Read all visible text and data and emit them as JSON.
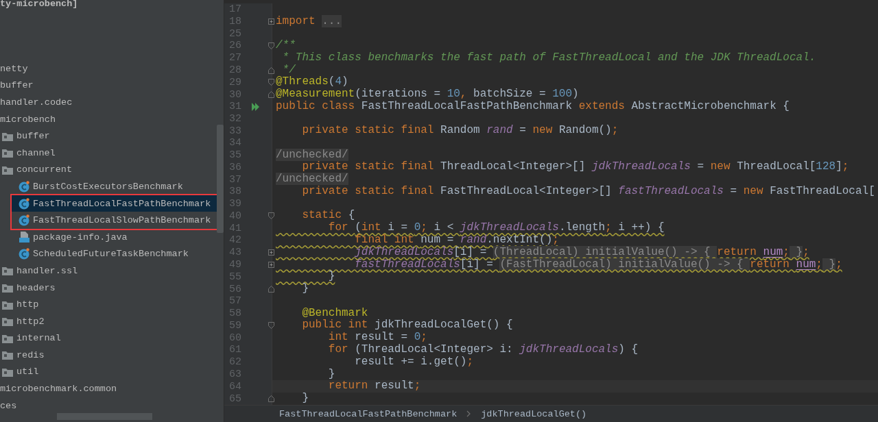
{
  "project_tree": {
    "header": "ty-microbench]",
    "items": [
      {
        "label": "netty",
        "kind": "package",
        "selected": false,
        "marked": false
      },
      {
        "label": "buffer",
        "kind": "package",
        "selected": false,
        "marked": false
      },
      {
        "label": "handler.codec",
        "kind": "package",
        "selected": false,
        "marked": false
      },
      {
        "label": "microbench",
        "kind": "package",
        "selected": false,
        "marked": false,
        "children": [
          {
            "label": "buffer",
            "kind": "folder",
            "selected": false,
            "marked": false
          },
          {
            "label": "channel",
            "kind": "folder",
            "selected": false,
            "marked": false
          },
          {
            "label": "concurrent",
            "kind": "folder",
            "selected": false,
            "marked": false,
            "children": [
              {
                "label": "BurstCostExecutorsBenchmark",
                "kind": "class",
                "selected": false,
                "marked": false
              },
              {
                "label": "FastThreadLocalFastPathBenchmark",
                "kind": "class",
                "selected": true,
                "marked": true
              },
              {
                "label": "FastThreadLocalSlowPathBenchmark",
                "kind": "class",
                "selected": false,
                "marked": true
              },
              {
                "label": "package-info.java",
                "kind": "java-file",
                "selected": false,
                "marked": false
              },
              {
                "label": "ScheduledFutureTaskBenchmark",
                "kind": "class",
                "selected": false,
                "marked": false
              }
            ]
          },
          {
            "label": "handler.ssl",
            "kind": "folder",
            "selected": false,
            "marked": false
          },
          {
            "label": "headers",
            "kind": "folder",
            "selected": false,
            "marked": false
          },
          {
            "label": "http",
            "kind": "folder",
            "selected": false,
            "marked": false
          },
          {
            "label": "http2",
            "kind": "folder",
            "selected": false,
            "marked": false
          },
          {
            "label": "internal",
            "kind": "folder",
            "selected": false,
            "marked": false
          },
          {
            "label": "redis",
            "kind": "folder",
            "selected": false,
            "marked": false
          },
          {
            "label": "util",
            "kind": "folder",
            "selected": false,
            "marked": false
          }
        ]
      },
      {
        "label": "microbenchmark.common",
        "kind": "package",
        "selected": false,
        "marked": false
      },
      {
        "label": "ces",
        "kind": "package",
        "selected": false,
        "marked": false
      }
    ]
  },
  "editor": {
    "lines": [
      {
        "n": "17"
      },
      {
        "n": "18",
        "fold": {
          "kind": "collapsed"
        },
        "tokens": [
          {
            "kind": "kw",
            "t": "import "
          },
          {
            "kind": "folded",
            "t": "..."
          }
        ]
      },
      {
        "n": "25"
      },
      {
        "n": "26",
        "fold": {
          "kind": "open"
        },
        "tokens": [
          {
            "kind": "doc",
            "t": "/**"
          }
        ]
      },
      {
        "n": "27",
        "tokens": [
          {
            "kind": "doc",
            "t": " * This class benchmarks the fast path of FastThreadLocal and the JDK ThreadLocal."
          }
        ]
      },
      {
        "n": "28",
        "fold": {
          "kind": "close"
        },
        "tokens": [
          {
            "kind": "doc",
            "t": " */"
          }
        ]
      },
      {
        "n": "29",
        "fold": {
          "kind": "open"
        },
        "tokens": [
          {
            "kind": "ann",
            "t": "@Threads"
          },
          {
            "kind": "plain",
            "t": "("
          },
          {
            "kind": "num",
            "t": "4"
          },
          {
            "kind": "plain",
            "t": ")"
          }
        ]
      },
      {
        "n": "30",
        "fold": {
          "kind": "close"
        },
        "tokens": [
          {
            "kind": "ann",
            "t": "@Measurement"
          },
          {
            "kind": "plain",
            "t": "(iterations = "
          },
          {
            "kind": "num",
            "t": "10"
          },
          {
            "kind": "kw",
            "t": ", "
          },
          {
            "kind": "plain",
            "t": "batchSize = "
          },
          {
            "kind": "num",
            "t": "100"
          },
          {
            "kind": "plain",
            "t": ")"
          }
        ]
      },
      {
        "n": "31",
        "run": true,
        "tokens": [
          {
            "kind": "kw",
            "t": "public class "
          },
          {
            "kind": "plain",
            "t": "FastThreadLocalFastPathBenchmark "
          },
          {
            "kind": "kw",
            "t": "extends "
          },
          {
            "kind": "plain",
            "t": "AbstractMicrobenchmark {"
          }
        ]
      },
      {
        "n": "32"
      },
      {
        "n": "33",
        "tokens": [
          {
            "kind": "kw",
            "t": "    private static final "
          },
          {
            "kind": "plain",
            "t": "Random "
          },
          {
            "kind": "field",
            "t": "rand"
          },
          {
            "kind": "plain",
            "t": " = "
          },
          {
            "kind": "kw",
            "t": "new "
          },
          {
            "kind": "plain",
            "t": "Random()"
          },
          {
            "kind": "kw",
            "t": ";"
          }
        ]
      },
      {
        "n": "34"
      },
      {
        "n": "35",
        "tokens": [
          {
            "kind": "folded",
            "t": "/unchecked/"
          }
        ]
      },
      {
        "n": "36",
        "tokens": [
          {
            "kind": "kw",
            "t": "    private static final "
          },
          {
            "kind": "plain",
            "t": "ThreadLocal<Integer>[] "
          },
          {
            "kind": "field",
            "t": "jdkThreadLocals"
          },
          {
            "kind": "plain",
            "t": " = "
          },
          {
            "kind": "kw",
            "t": "new "
          },
          {
            "kind": "plain",
            "t": "ThreadLocal["
          },
          {
            "kind": "num",
            "t": "128"
          },
          {
            "kind": "plain",
            "t": "]"
          },
          {
            "kind": "kw",
            "t": ";"
          }
        ]
      },
      {
        "n": "37",
        "tokens": [
          {
            "kind": "folded",
            "t": "/unchecked/"
          }
        ]
      },
      {
        "n": "38",
        "tokens": [
          {
            "kind": "kw",
            "t": "    private static final "
          },
          {
            "kind": "plain",
            "t": "FastThreadLocal<Integer>[] "
          },
          {
            "kind": "field",
            "t": "fastThreadLocals"
          },
          {
            "kind": "plain",
            "t": " = "
          },
          {
            "kind": "kw",
            "t": "new "
          },
          {
            "kind": "plain",
            "t": "FastThreadLocal["
          }
        ]
      },
      {
        "n": "39"
      },
      {
        "n": "40",
        "fold": {
          "kind": "open"
        },
        "tokens": [
          {
            "kind": "kw",
            "t": "    static "
          },
          {
            "kind": "plain",
            "t": "{"
          }
        ]
      },
      {
        "n": "41",
        "warning": true,
        "tokens": [
          {
            "kind": "kw",
            "t": "        for "
          },
          {
            "kind": "plain",
            "t": "("
          },
          {
            "kind": "kw",
            "t": "int "
          },
          {
            "kind": "plain",
            "t": "i = "
          },
          {
            "kind": "num",
            "t": "0"
          },
          {
            "kind": "kw",
            "t": "; "
          },
          {
            "kind": "plain",
            "t": "i < "
          },
          {
            "kind": "field",
            "t": "jdkThreadLocals"
          },
          {
            "kind": "plain",
            "t": ".length"
          },
          {
            "kind": "kw",
            "t": "; "
          },
          {
            "kind": "plain",
            "t": "i ++) {"
          }
        ]
      },
      {
        "n": "42",
        "warning": true,
        "tokens": [
          {
            "kind": "kw",
            "t": "            final int "
          },
          {
            "kind": "plain",
            "t": "num = "
          },
          {
            "kind": "field",
            "t": "rand"
          },
          {
            "kind": "plain",
            "t": ".nextInt()"
          },
          {
            "kind": "kw",
            "t": ";"
          }
        ]
      },
      {
        "n": "43",
        "fold": {
          "kind": "collapsed"
        },
        "warning": true,
        "tokens": [
          {
            "kind": "field",
            "t": "            jdkThreadLocals"
          },
          {
            "kind": "plain",
            "t": "[i] = "
          },
          {
            "kind": "folded",
            "t": "(ThreadLocal) initialValue() -> { "
          },
          {
            "kind": "kw",
            "t": "return "
          },
          {
            "kind": "var",
            "t": "num"
          },
          {
            "kind": "kw",
            "t": ";"
          },
          {
            "kind": "folded",
            "t": " }"
          },
          {
            "kind": "kw",
            "t": ";"
          }
        ]
      },
      {
        "n": "49",
        "fold": {
          "kind": "collapsed"
        },
        "warning": true,
        "tokens": [
          {
            "kind": "field",
            "t": "            fastThreadLocals"
          },
          {
            "kind": "plain",
            "t": "[i] = "
          },
          {
            "kind": "folded",
            "t": "(FastThreadLocal) initialValue() -> { "
          },
          {
            "kind": "kw",
            "t": "return "
          },
          {
            "kind": "var",
            "t": "num"
          },
          {
            "kind": "kw",
            "t": ";"
          },
          {
            "kind": "folded",
            "t": " }"
          },
          {
            "kind": "kw",
            "t": ";"
          }
        ]
      },
      {
        "n": "55",
        "warning": true,
        "tokens": [
          {
            "kind": "plain",
            "t": "        }"
          }
        ]
      },
      {
        "n": "56",
        "fold": {
          "kind": "close"
        },
        "tokens": [
          {
            "kind": "plain",
            "t": "    }"
          }
        ]
      },
      {
        "n": "57"
      },
      {
        "n": "58",
        "tokens": [
          {
            "kind": "ann",
            "t": "    @Benchmark"
          }
        ]
      },
      {
        "n": "59",
        "fold": {
          "kind": "open"
        },
        "tokens": [
          {
            "kind": "kw",
            "t": "    public int "
          },
          {
            "kind": "plain",
            "t": "jdkThreadLocalGet() {"
          }
        ]
      },
      {
        "n": "60",
        "tokens": [
          {
            "kind": "kw",
            "t": "        int "
          },
          {
            "kind": "plain",
            "t": "result = "
          },
          {
            "kind": "num",
            "t": "0"
          },
          {
            "kind": "kw",
            "t": ";"
          }
        ]
      },
      {
        "n": "61",
        "tokens": [
          {
            "kind": "kw",
            "t": "        for "
          },
          {
            "kind": "plain",
            "t": "(ThreadLocal<Integer> i: "
          },
          {
            "kind": "field",
            "t": "jdkThreadLocals"
          },
          {
            "kind": "plain",
            "t": ") {"
          }
        ]
      },
      {
        "n": "62",
        "tokens": [
          {
            "kind": "plain",
            "t": "            result += i.get()"
          },
          {
            "kind": "kw",
            "t": ";"
          }
        ]
      },
      {
        "n": "63",
        "tokens": [
          {
            "kind": "plain",
            "t": "        }"
          }
        ]
      },
      {
        "n": "64",
        "current": true,
        "tokens": [
          {
            "kind": "kw",
            "t": "        return "
          },
          {
            "kind": "plain",
            "t": "result"
          },
          {
            "kind": "kw",
            "t": ";"
          }
        ]
      },
      {
        "n": "65",
        "fold": {
          "kind": "close"
        },
        "tokens": [
          {
            "kind": "plain",
            "t": "    }"
          }
        ]
      }
    ]
  },
  "breadcrumbs": [
    "FastThreadLocalFastPathBenchmark",
    "jdkThreadLocalGet()"
  ]
}
